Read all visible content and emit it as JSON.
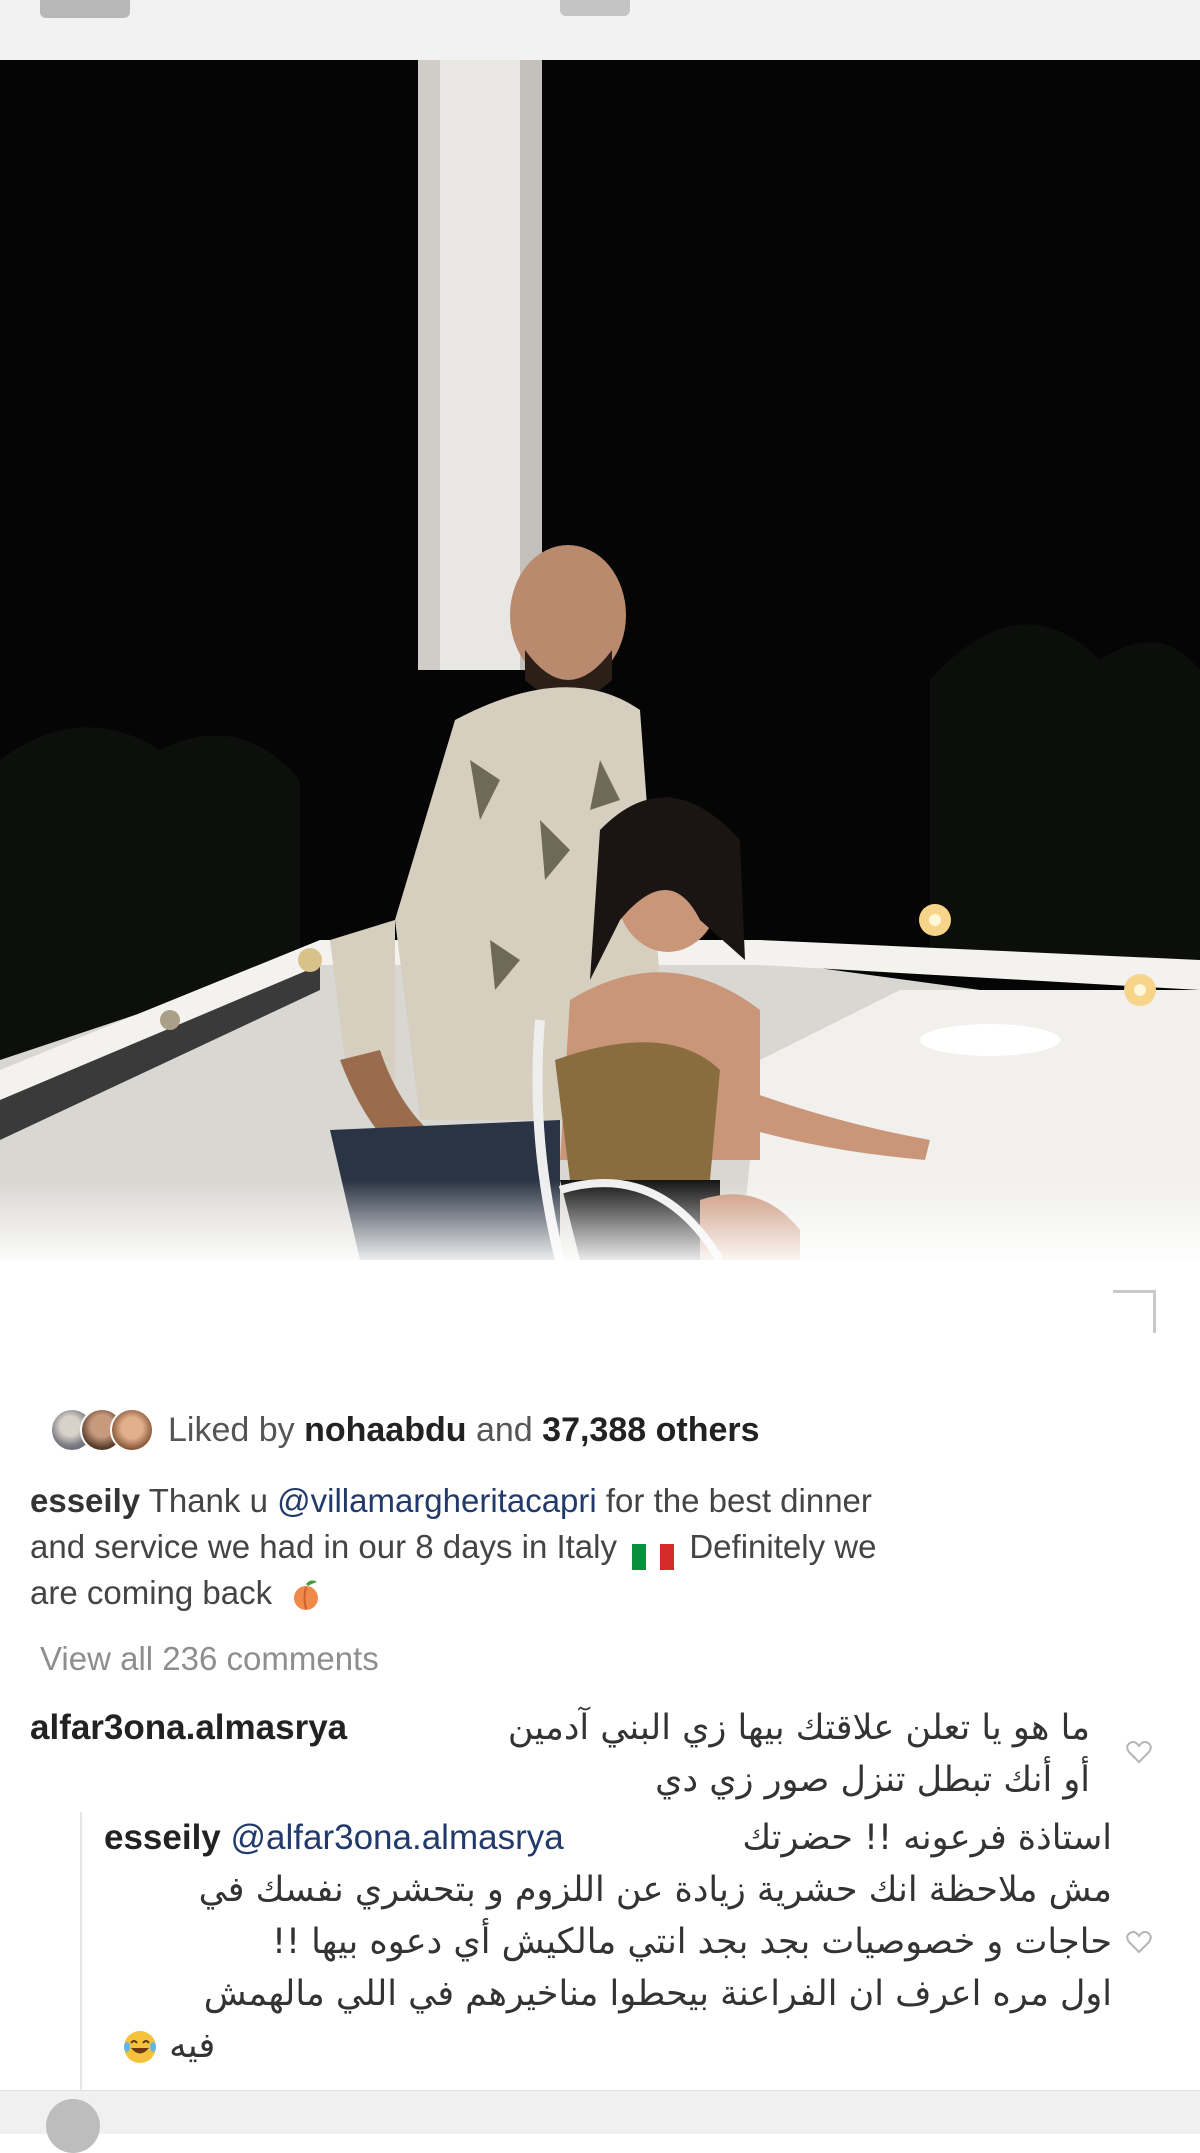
{
  "post": {
    "likes": {
      "prefix": "Liked by",
      "user": "nohaabdu",
      "conjunction": "and",
      "count": "37,388 others"
    },
    "caption": {
      "user": "esseily",
      "text_before": "Thank u",
      "mention": "@villamargheritacapri",
      "text_after_line1": "for the best dinner",
      "line2_start": "and service we had in our 8 days in Italy",
      "line2_end": "Definitely we",
      "line3": "are coming back",
      "flag_icon": "italy-flag-icon",
      "emoji_icon": "peach-icon"
    },
    "view_all_comments": "View all 236 comments",
    "comments": [
      {
        "user": "alfar3ona.almasrya",
        "line1": "ما هو يا تعلن علاقتك بيها زي البني آدمين",
        "line2": "أو أنك تبطل تنزل صور زي دي"
      }
    ],
    "reply": {
      "user": "esseily",
      "mention": "@alfar3ona.almasrya",
      "head_text": "استاذة فرعونه !! حضرتك",
      "line2": "مش ملاحظة انك حشرية زيادة عن اللزوم و بتحشري نفسك في",
      "line3": "حاجات و خصوصيات بجد بجد انتي مالكيش أي دعوه بيها !!",
      "line4": "اول مره اعرف ان الفراعنة بيحطوا مناخيرهم في اللي مالهمش",
      "line5": "فيه",
      "emoji_icon": "tears-of-joy-icon"
    }
  },
  "colors": {
    "text": "#262626",
    "muted": "#8e8e8e",
    "mention": "#223a6b",
    "night": "#000000",
    "railing": "#e8e8e8"
  }
}
